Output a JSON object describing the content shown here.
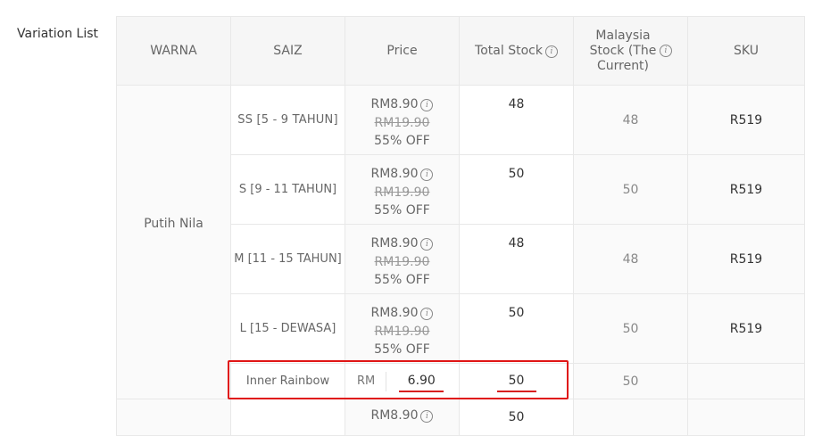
{
  "section_label": "Variation List",
  "headers": {
    "warna": "WARNA",
    "saiz": "SAIZ",
    "price": "Price",
    "total_stock": "Total Stock",
    "malaysia_stock": "Malaysia Stock (The Current)",
    "sku": "SKU"
  },
  "group_color": "Putih Nila",
  "rows": [
    {
      "size": "SS [5 - 9 TAHUN]",
      "price": "RM8.90",
      "original": "RM19.90",
      "discount": "55% OFF",
      "total_stock": "48",
      "malaysia_stock": "48",
      "sku": "R519"
    },
    {
      "size": "S [9 - 11 TAHUN]",
      "price": "RM8.90",
      "original": "RM19.90",
      "discount": "55% OFF",
      "total_stock": "50",
      "malaysia_stock": "50",
      "sku": "R519"
    },
    {
      "size": "M [11 - 15 TAHUN]",
      "price": "RM8.90",
      "original": "RM19.90",
      "discount": "55% OFF",
      "total_stock": "48",
      "malaysia_stock": "48",
      "sku": "R519"
    },
    {
      "size": "L [15 - DEWASA]",
      "price": "RM8.90",
      "original": "RM19.90",
      "discount": "55% OFF",
      "total_stock": "50",
      "malaysia_stock": "50",
      "sku": "R519"
    }
  ],
  "edit_row": {
    "size": "Inner Rainbow",
    "currency": "RM",
    "price_value": "6.90",
    "total_stock": "50",
    "malaysia_stock": "50"
  },
  "partial_row": {
    "price": "RM8.90",
    "total_stock": "50"
  },
  "colors": {
    "highlight": "#e01515",
    "underline": "#d81e1e",
    "header_bg": "#f6f6f6",
    "border": "#e8e8e8"
  }
}
